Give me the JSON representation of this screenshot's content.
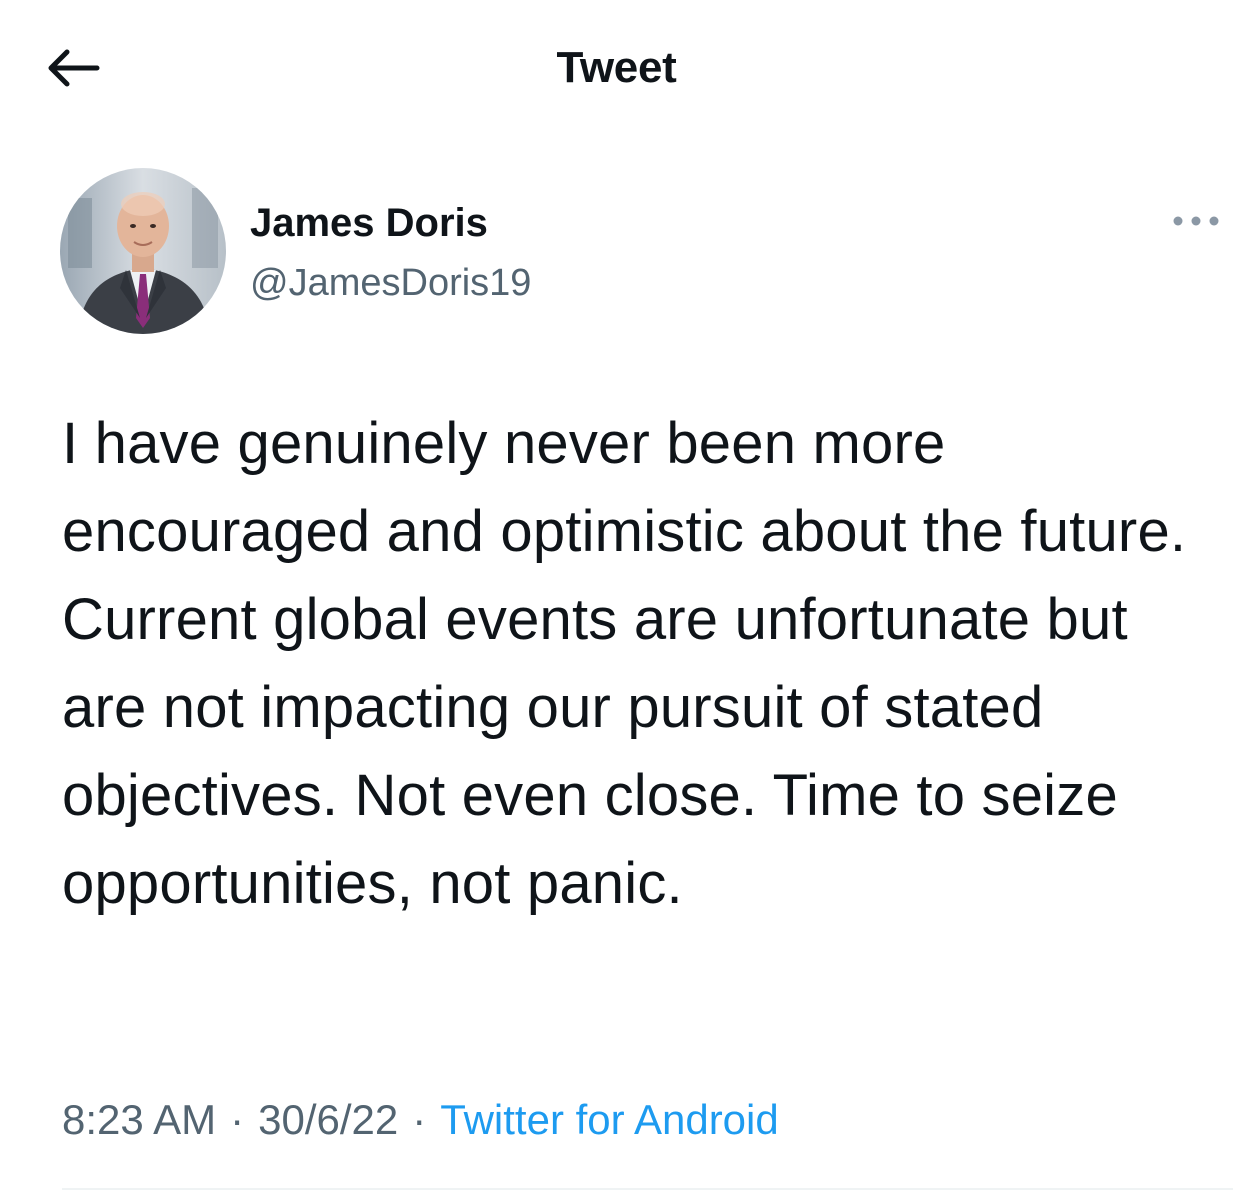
{
  "header": {
    "back_icon": "arrow-left-icon",
    "title": "Tweet"
  },
  "tweet": {
    "author": {
      "display_name": "James Doris",
      "handle": "@JamesDoris19",
      "avatar_icon": "profile-photo"
    },
    "more_icon": "more-options-icon",
    "text": "I have genuinely never been more encouraged and optimistic about the future. Current global events are unfortunate but are not impacting our pursuit of stated objectives. Not even close. Time to seize opportunities, not panic.",
    "time": "8:23 AM",
    "separator": "·",
    "date": "30/6/22",
    "source": "Twitter for Android"
  },
  "colors": {
    "text_primary": "#0f1419",
    "text_secondary": "#536471",
    "link": "#1d9bf0",
    "divider": "#eff3f4"
  }
}
